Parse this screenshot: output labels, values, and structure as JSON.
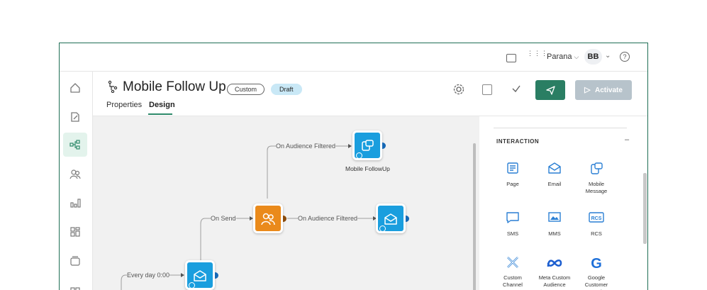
{
  "topbar": {
    "workspace": "Parana",
    "workspace_chevron": "⌵",
    "user_initials": "BB",
    "user_chevron": "⌄",
    "help": "?",
    "icons": [
      "chat-icon",
      "apps-grid-icon",
      "help-icon"
    ]
  },
  "nav": {
    "items": [
      {
        "name": "home",
        "icon": "home-icon"
      },
      {
        "name": "content",
        "icon": "document-edit-icon"
      },
      {
        "name": "flows",
        "icon": "flow-icon",
        "active": true
      },
      {
        "name": "audiences",
        "icon": "people-icon"
      },
      {
        "name": "analytics",
        "icon": "bar-chart-icon"
      },
      {
        "name": "dashboards",
        "icon": "layout-icon"
      },
      {
        "name": "assets",
        "icon": "folder-icon"
      },
      {
        "name": "more",
        "icon": "blocks-icon"
      }
    ]
  },
  "header": {
    "title": "Mobile Follow Up",
    "badge_type": "Custom",
    "badge_status": "Draft",
    "tabs": [
      {
        "label": "Properties",
        "active": false
      },
      {
        "label": "Design",
        "active": true
      }
    ],
    "activate_label": "Activate",
    "activate_icon": "▷"
  },
  "canvas": {
    "connectors": [
      {
        "label": "On Audience Filtered"
      },
      {
        "label": "On Send"
      },
      {
        "label": "On Audience Filtered"
      },
      {
        "label": "Every day 0:00"
      }
    ],
    "nodes": [
      {
        "name": "mobile-message-node",
        "label": "Mobile FollowUp",
        "color": "#1a9ede"
      },
      {
        "name": "audience-filter-node",
        "label": "",
        "color": "#ea8a1b"
      },
      {
        "name": "email-node",
        "label": "",
        "color": "#1a9ede"
      },
      {
        "name": "scheduled-email-node",
        "label": "",
        "color": "#1a9ede"
      }
    ]
  },
  "panel": {
    "section_title": "INTERACTION",
    "collapse": "–",
    "tiles": [
      {
        "label": "Page",
        "icon": "page-icon",
        "glyph": "▤"
      },
      {
        "label": "Email",
        "icon": "email-icon",
        "glyph": "✉"
      },
      {
        "label": "Mobile\nMessage",
        "icon": "mobile-message-icon",
        "glyph": "📱"
      },
      {
        "label": "SMS",
        "icon": "sms-icon",
        "glyph": "▭"
      },
      {
        "label": "MMS",
        "icon": "mms-icon",
        "glyph": "▣"
      },
      {
        "label": "RCS",
        "icon": "rcs-icon",
        "glyph": "RCS"
      },
      {
        "label": "Custom\nChannel",
        "icon": "tools-icon",
        "glyph": "✕"
      },
      {
        "label": "Meta Custom\nAudience",
        "icon": "meta-icon",
        "glyph": "∞"
      },
      {
        "label": "Google\nCustomer\nMatch",
        "icon": "google-icon",
        "glyph": "G"
      }
    ]
  },
  "colors": {
    "accent": "#2a7e63",
    "node_blue": "#1a9ede",
    "node_orange": "#ea8a1b",
    "draft_badge": "#c9e8f6",
    "activate_disabled": "#b7c3cb"
  }
}
